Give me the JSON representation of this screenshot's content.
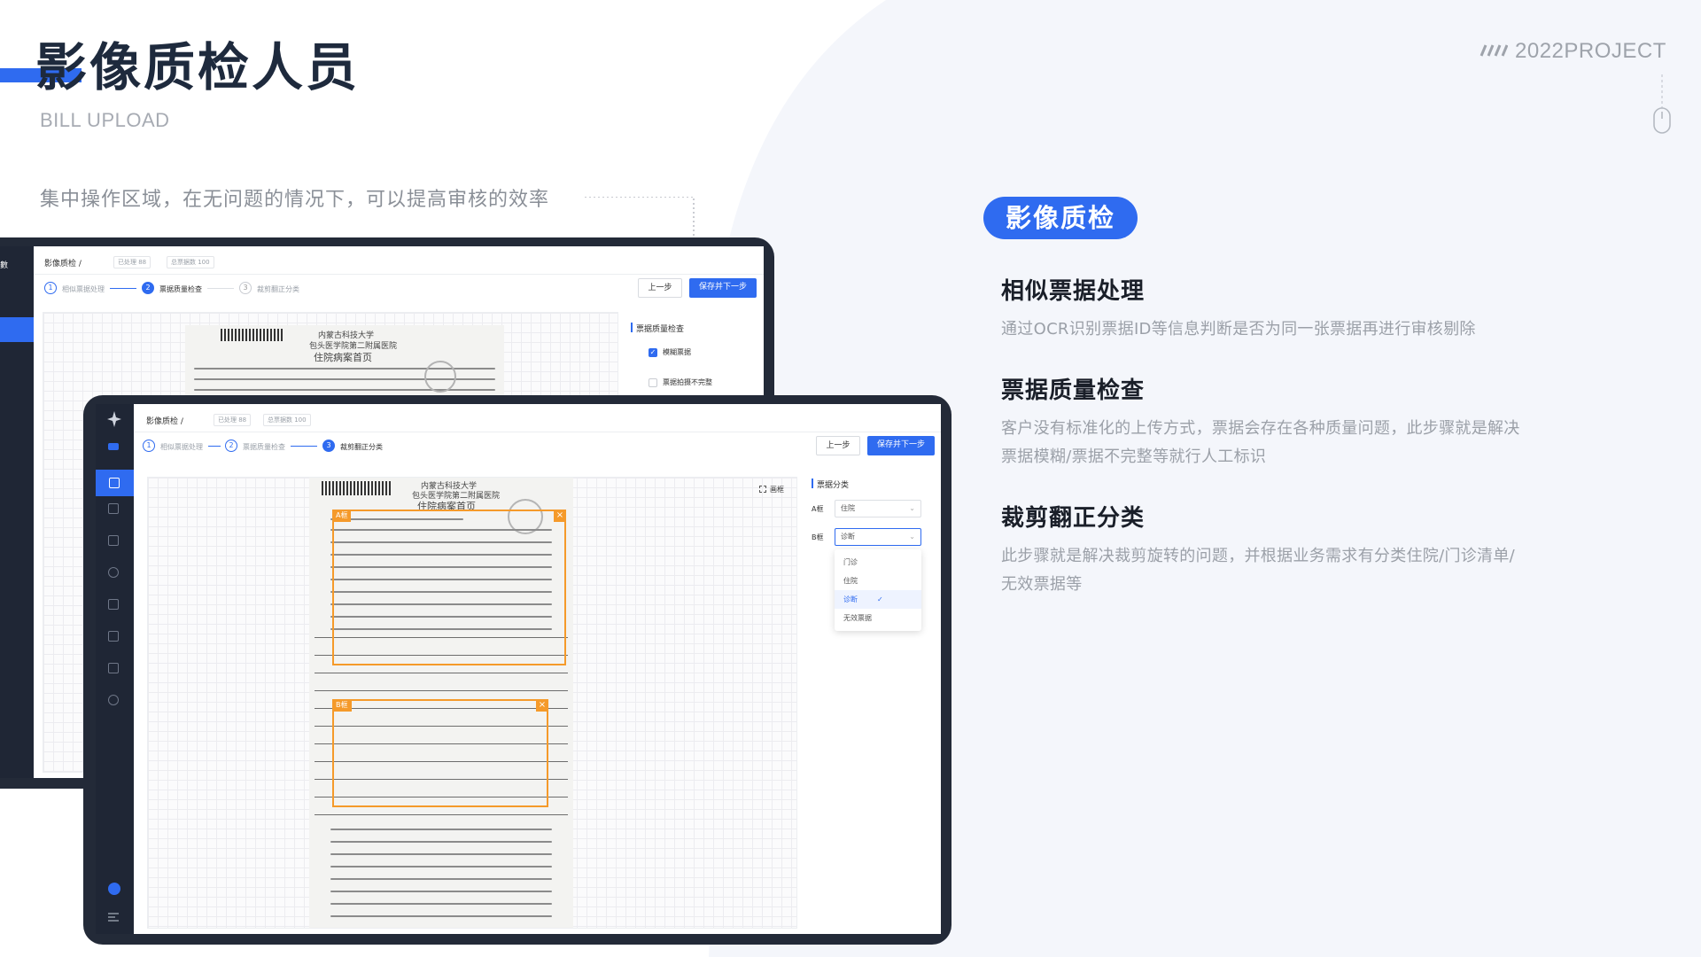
{
  "header": {
    "title": "影像质检人员",
    "subtitle": "BILL UPLOAD",
    "project_label": "2022PROJECT",
    "description": "集中操作区域，在无问题的情况下，可以提高审核的效率"
  },
  "back_screen": {
    "sidebar_label": "數",
    "breadcrumb": "影像质检 /",
    "chip_processed": "已处理 88",
    "chip_total": "总票据数 100",
    "steps": [
      "相似票据处理",
      "票据质量检查",
      "裁剪翻正分类"
    ],
    "step_nums": [
      "1",
      "2",
      "3"
    ],
    "prev_button": "上一步",
    "next_button": "保存并下一步",
    "panel_title": "票据质量检查",
    "options": [
      "模糊票据",
      "票据拍摄不完整"
    ]
  },
  "front_screen": {
    "breadcrumb": "影像质检 /",
    "chip_processed": "已处理 88",
    "chip_total": "总票据数 100",
    "steps": [
      "相似票据处理",
      "票据质量检查",
      "裁剪翻正分类"
    ],
    "step_nums": [
      "1",
      "2",
      "3"
    ],
    "prev_button": "上一步",
    "next_button": "保存并下一步",
    "draw_box_label": "画框",
    "frame_a_tag": "A框",
    "frame_b_tag": "B框",
    "frame_close": "×",
    "panel_title": "票据分类",
    "field_a_label": "A框",
    "field_a_value": "住院",
    "field_b_label": "B框",
    "field_b_value": "诊断",
    "dropdown_options": [
      "门诊",
      "住院",
      "诊断",
      "无效票据"
    ],
    "dropdown_selected_index": 2,
    "document": {
      "university": "内蒙古科技大学",
      "hospital": "包头医学院第二附属医院",
      "form_title": "住院病案首页"
    }
  },
  "right_panel": {
    "pill": "影像质检",
    "sections": [
      {
        "title": "相似票据处理",
        "text": "通过OCR识别票据ID等信息判断是否为同一张票据再进行审核剔除"
      },
      {
        "title": "票据质量检查",
        "text": "客户没有标准化的上传方式，票据会存在各种质量问题，此步骤就是解决票据模糊/票据不完整等就行人工标识"
      },
      {
        "title": "裁剪翻正分类",
        "text": "此步骤就是解决裁剪旋转的问题，并根据业务需求有分类住院/门诊清单/无效票据等"
      }
    ]
  },
  "colors": {
    "accent": "#2f6bf0",
    "frame": "#f59a2a",
    "sidebar": "#1f2635",
    "device": "#232a38"
  },
  "icons": [
    "mouse-icon",
    "checkbox-checked-icon",
    "chevron-down-icon",
    "check-icon",
    "close-icon",
    "draw-box-icon",
    "logo-icon",
    "user-avatar-icon",
    "menu-icon"
  ]
}
